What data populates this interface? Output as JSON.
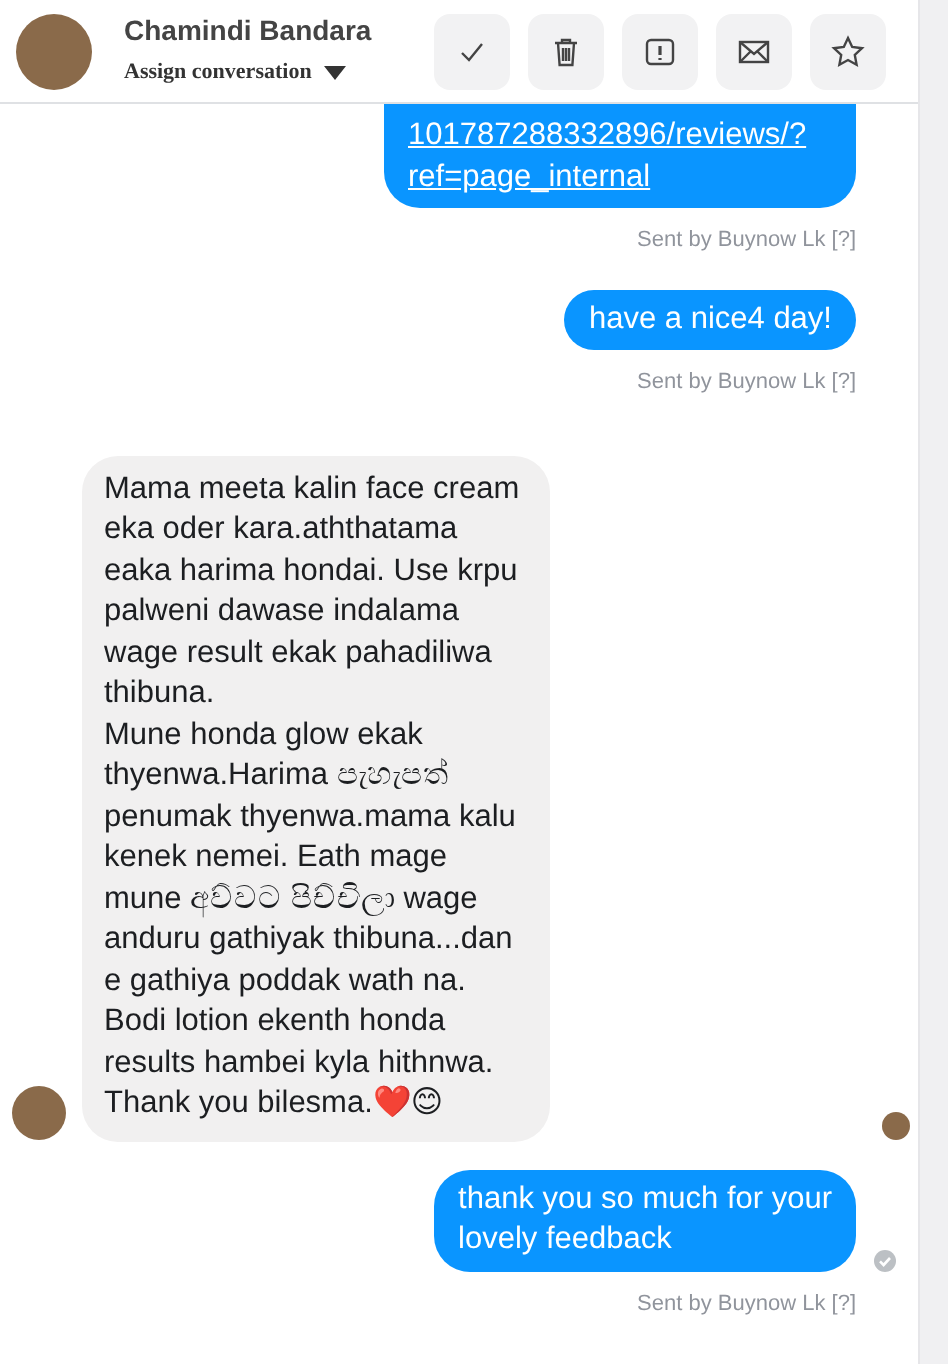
{
  "contact": {
    "name": "Chamindi Bandara",
    "assign_label": "Assign conversation"
  },
  "actions": [
    {
      "kind": "check"
    },
    {
      "kind": "trash"
    },
    {
      "kind": "alert"
    },
    {
      "kind": "mail"
    },
    {
      "kind": "star"
    }
  ],
  "messages": [
    {
      "kind": "outgoing_link",
      "cut_top": true,
      "text": "101787288332896/reviews/?\nref=page_internal",
      "sent_by": "Sent by Buynow Lk [?]"
    },
    {
      "kind": "outgoing",
      "text": "have a nice4 day!",
      "sent_by": "Sent by Buynow Lk [?]"
    },
    {
      "kind": "incoming",
      "text": "Mama meeta kalin face cream\neka oder kara.aththatama\neaka harima hondai. Use krpu\npalweni dawase indalama\nwage result ekak pahadiliwa\nthibuna.\nMune honda glow ekak\nthyenwa.Harima පැහැපත්\npenumak thyenwa.mama kalu\nkenek nemei. Eath mage\nmune අව්වට පිච්චිලා  wage\nanduru gathiyak thibuna...dan\ne gathiya poddak wath na.\nBodi lotion ekenth honda\nresults hambei kyla hithnwa.\nThank you bilesma.❤️😊",
      "seen": true
    },
    {
      "kind": "outgoing",
      "text": "thank you so much for your\nlovely feedback",
      "sent_by": "Sent by Buynow Lk [?]",
      "delivered": true
    }
  ]
}
